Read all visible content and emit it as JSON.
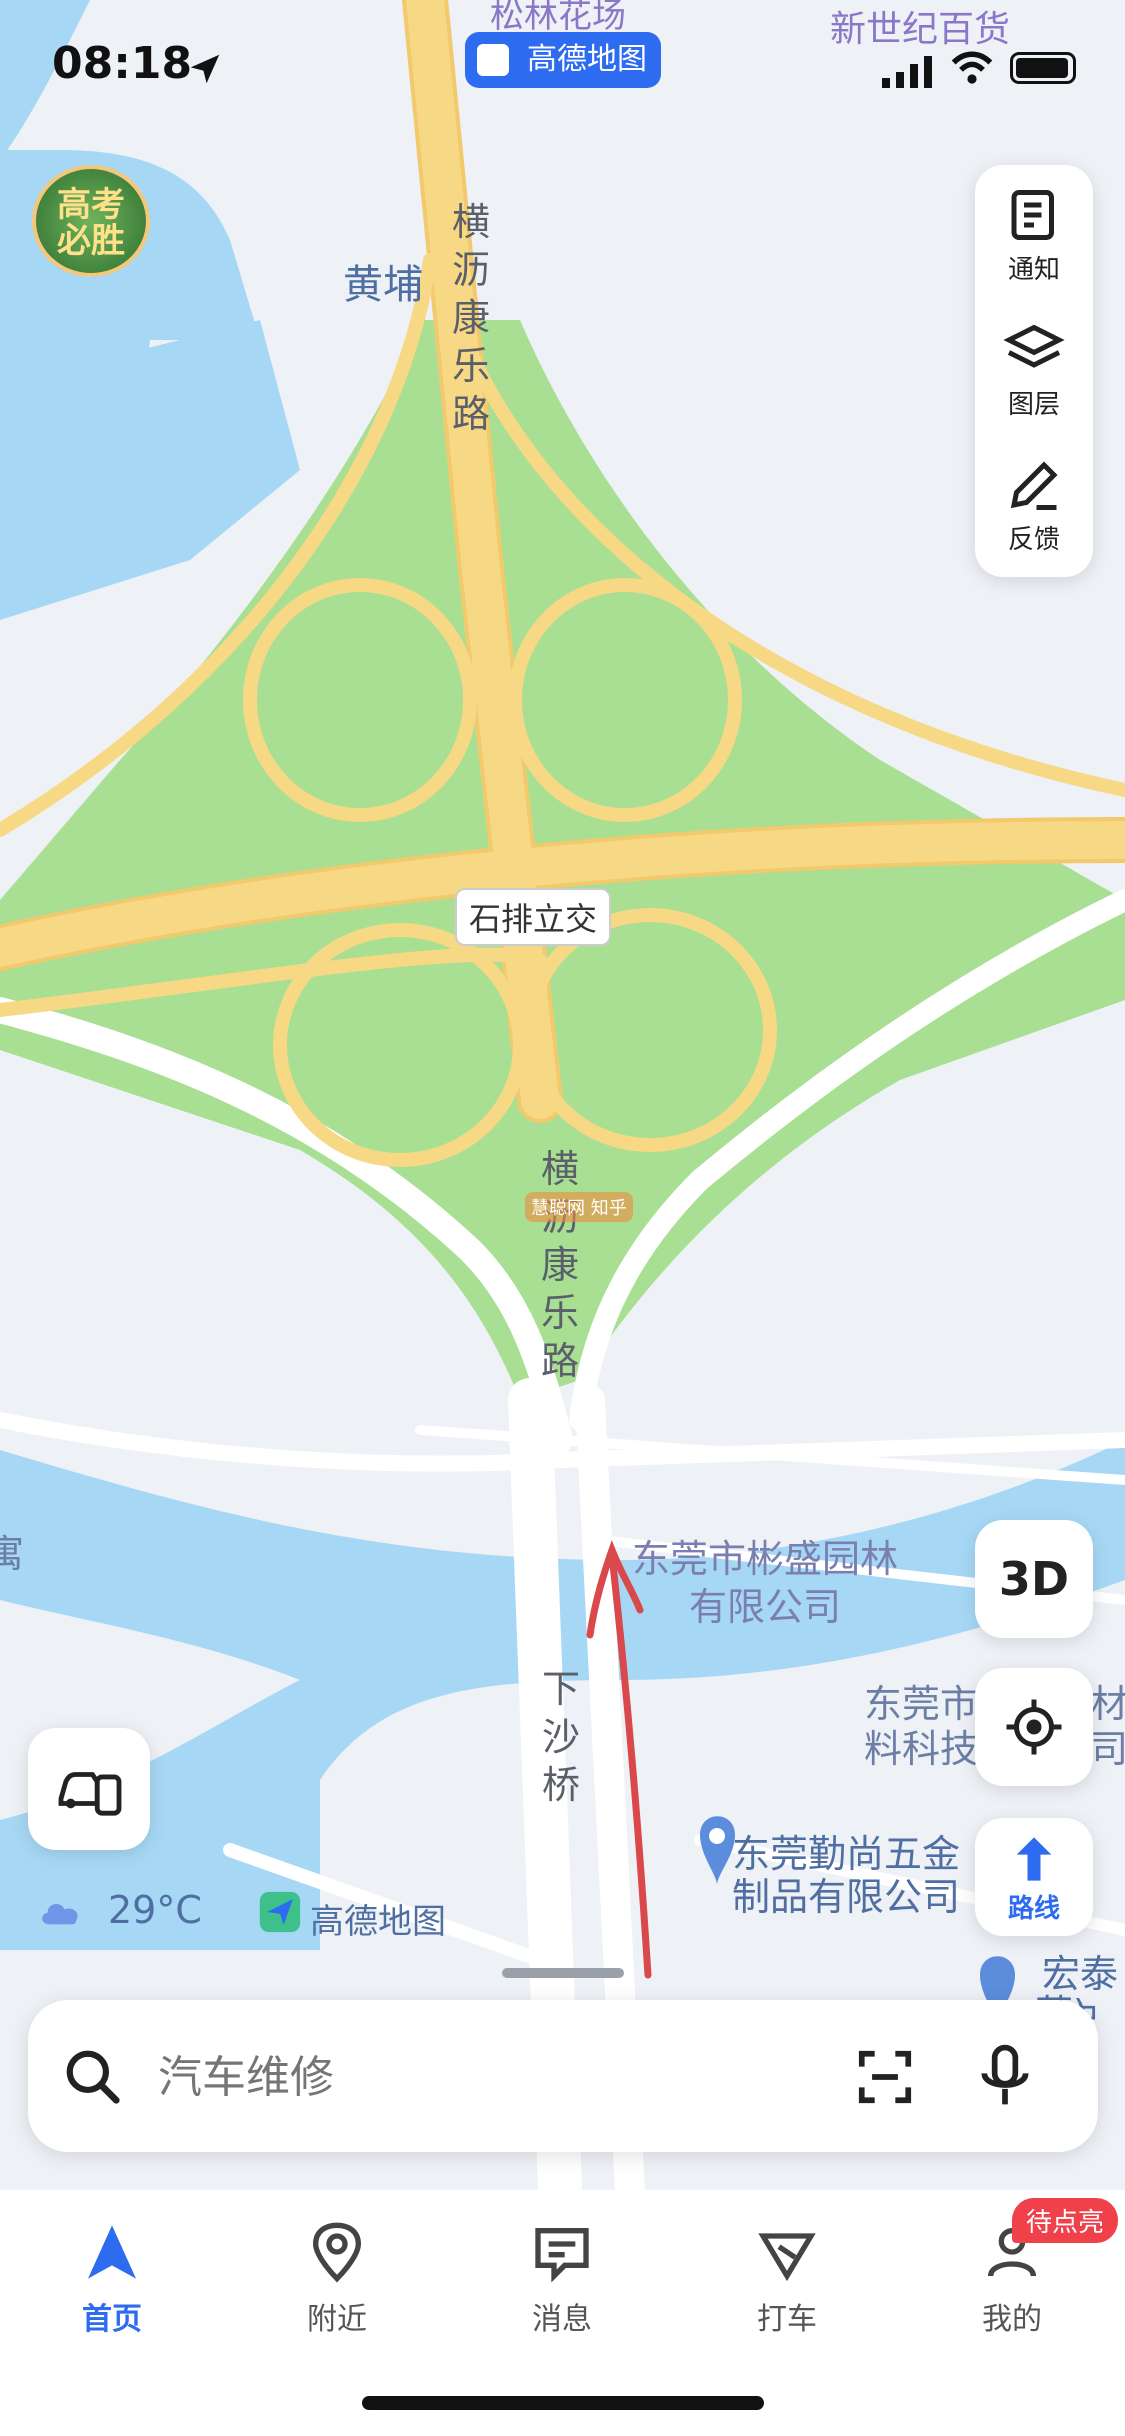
{
  "status_bar": {
    "time": "08:18",
    "location_arrow": "location-arrow-icon"
  },
  "map": {
    "labels": {
      "top_poi": "松林花场",
      "top_right_poi": "新世纪百货",
      "amap_badge": "高德地图",
      "huangpu": "黄埔",
      "road_north": "横沥康乐路",
      "interchange": "石排立交",
      "road_south": "横沥康乐路",
      "bridge": "下沙桥",
      "poi_company1": "东莞市彬盛园林有限公司",
      "poi_company2_line1": "东莞市",
      "poi_company2_line2": "料科技",
      "poi_company3_line1": "东莞勤尚五金",
      "poi_company3_line2": "制品有限公司",
      "poi_edge1_line1": "材",
      "poi_edge1_line2": "司",
      "poi_edge2_line1": "宏泰智",
      "poi_edge2_line2": "莞)",
      "left_edge": "寓",
      "watermark1": "慧聪网",
      "watermark2": "知乎"
    },
    "promo_badge": "高考必胜",
    "weather": {
      "temp": "29°C",
      "icon": "cloud-icon"
    },
    "brand": "高德地图"
  },
  "tools": {
    "notice": "通知",
    "layers": "图层",
    "feedback": "反馈",
    "three_d": "3D",
    "route": "路线"
  },
  "search": {
    "placeholder": "汽车维修"
  },
  "tabs": [
    {
      "label": "首页",
      "icon": "navigate-arrow-icon",
      "active": true
    },
    {
      "label": "附近",
      "icon": "location-pin-icon",
      "active": false
    },
    {
      "label": "消息",
      "icon": "message-icon",
      "active": false
    },
    {
      "label": "打车",
      "icon": "taxi-icon",
      "active": false
    },
    {
      "label": "我的",
      "icon": "user-icon",
      "active": false,
      "badge": "待点亮"
    }
  ],
  "colors": {
    "accent": "#2d6bf0",
    "water": "#a6d8f5",
    "green": "#a8df93",
    "road_yellow": "#f7d885",
    "road_white": "#ffffff",
    "badge_red": "#f0404a"
  }
}
